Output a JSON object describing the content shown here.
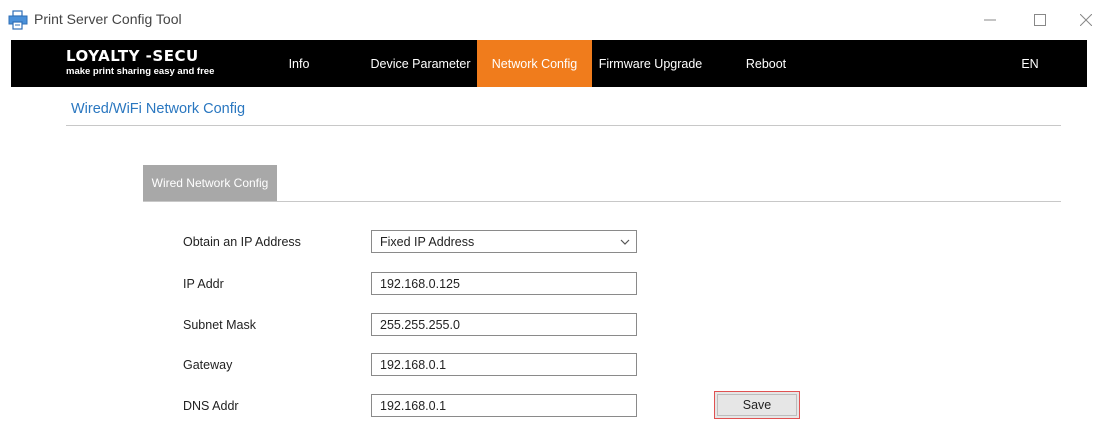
{
  "window": {
    "title": "Print Server Config Tool",
    "controls": {
      "minimize": "—",
      "maximize": "☐",
      "close": "✕"
    }
  },
  "header": {
    "logo_main": "LOYALTY -SECU",
    "logo_sub": "make print sharing easy and free",
    "nav": [
      {
        "label": "Info"
      },
      {
        "label": "Device Parameter"
      },
      {
        "label": "Network Config",
        "active": true
      },
      {
        "label": "Firmware Upgrade"
      },
      {
        "label": "Reboot"
      }
    ],
    "language": "EN"
  },
  "section": {
    "title": "Wired/WiFi Network Config"
  },
  "tab": {
    "label": "Wired Network Config"
  },
  "form": {
    "obtain_ip": {
      "label": "Obtain an IP Address",
      "value": "Fixed IP Address"
    },
    "ip_addr": {
      "label": "IP Addr",
      "value": "192.168.0.125"
    },
    "subnet_mask": {
      "label": "Subnet Mask",
      "value": "255.255.255.0"
    },
    "gateway": {
      "label": "Gateway",
      "value": "192.168.0.1"
    },
    "dns_addr": {
      "label": "DNS Addr",
      "value": "192.168.0.1"
    },
    "save_label": "Save"
  },
  "colors": {
    "nav_bg": "#000000",
    "nav_active": "#f07c1c",
    "section_title": "#2a77c0",
    "tab_bg": "#a8a8a8",
    "save_border": "#e05252"
  },
  "icons": {
    "app": "printer-network-icon",
    "select": "chevron-down-icon"
  }
}
